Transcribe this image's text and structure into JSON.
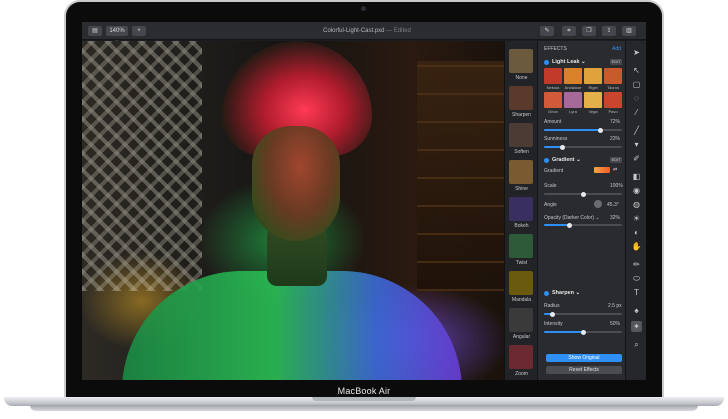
{
  "device": {
    "label": "MacBook Air"
  },
  "titlebar": {
    "zoom": "140%",
    "add": "+",
    "document": "Colorful-Light-Cast.pxd",
    "status": "— Edited"
  },
  "filters": [
    {
      "label": "None",
      "color": "#6b5a3e"
    },
    {
      "label": "Sharpen",
      "color": "#5a3a2a"
    },
    {
      "label": "Soften",
      "color": "#4c3a34"
    },
    {
      "label": "Shine",
      "color": "#7a5a30"
    },
    {
      "label": "Bokeh",
      "color": "#3a3060"
    },
    {
      "label": "Twist",
      "color": "#2f5a3a"
    },
    {
      "label": "Mandala",
      "color": "#6a5a10"
    },
    {
      "label": "Angular",
      "color": "#3a3a3a"
    },
    {
      "label": "Zoom",
      "color": "#6a2a30"
    }
  ],
  "effects": {
    "header": "EFFECTS",
    "add_label": "Add",
    "light_leak": {
      "title": "Light Leak ⌄",
      "chip": "EDIT",
      "presets": [
        {
          "name": "Nebula",
          "color": "#c23a2a"
        },
        {
          "name": "Andaluse",
          "color": "#d9822a"
        },
        {
          "name": "Rigel",
          "color": "#e0a23a"
        },
        {
          "name": "Taurus",
          "color": "#c85a2e"
        },
        {
          "name": "Orion",
          "color": "#d05a3a"
        },
        {
          "name": "Lyra",
          "color": "#a66a9a"
        },
        {
          "name": "Vega",
          "color": "#e4b04a"
        },
        {
          "name": "Pavo",
          "color": "#c9452e"
        }
      ],
      "amount_label": "Amount",
      "amount_value": "72%",
      "amount_fraction": 0.72,
      "sunniness_label": "Sunniness",
      "sunniness_value": "23%",
      "sunniness_fraction": 0.23
    },
    "gradient": {
      "title": "Gradient ⌄",
      "chip": "EDIT",
      "gradient_label": "Gradient",
      "scale_label": "Scale",
      "scale_value": "100%",
      "scale_fraction": 0.5,
      "angle_label": "Angle",
      "angle_value": "45.3°",
      "opacity_label": "Opacity (Darker Color) ⌄",
      "opacity_value": "32%",
      "opacity_fraction": 0.32
    },
    "sharpen": {
      "title": "Sharpen ⌄",
      "radius_label": "Radius",
      "radius_value": "2.5 px",
      "radius_fraction": 0.1,
      "intensity_label": "Intensity",
      "intensity_value": "50%",
      "intensity_fraction": 0.5
    },
    "show_original": "Show Original",
    "reset_effects": "Reset Effects"
  },
  "tools": [
    "arrow-tool",
    "select-tool",
    "lasso-tool",
    "brush-tool",
    "pen-tool",
    "fill-tool",
    "smudge-tool",
    "clone-tool",
    "dodge-tool",
    "burn-tool",
    "blur-tool",
    "sun-tool",
    "hand-drop-tool",
    "pencil-tool",
    "shape-tool",
    "text-tool",
    "paint-tool",
    "effects-tool",
    "zoom-tool"
  ],
  "colors": {
    "accent": "#2f8ff5",
    "panel": "#2a2b2f"
  }
}
